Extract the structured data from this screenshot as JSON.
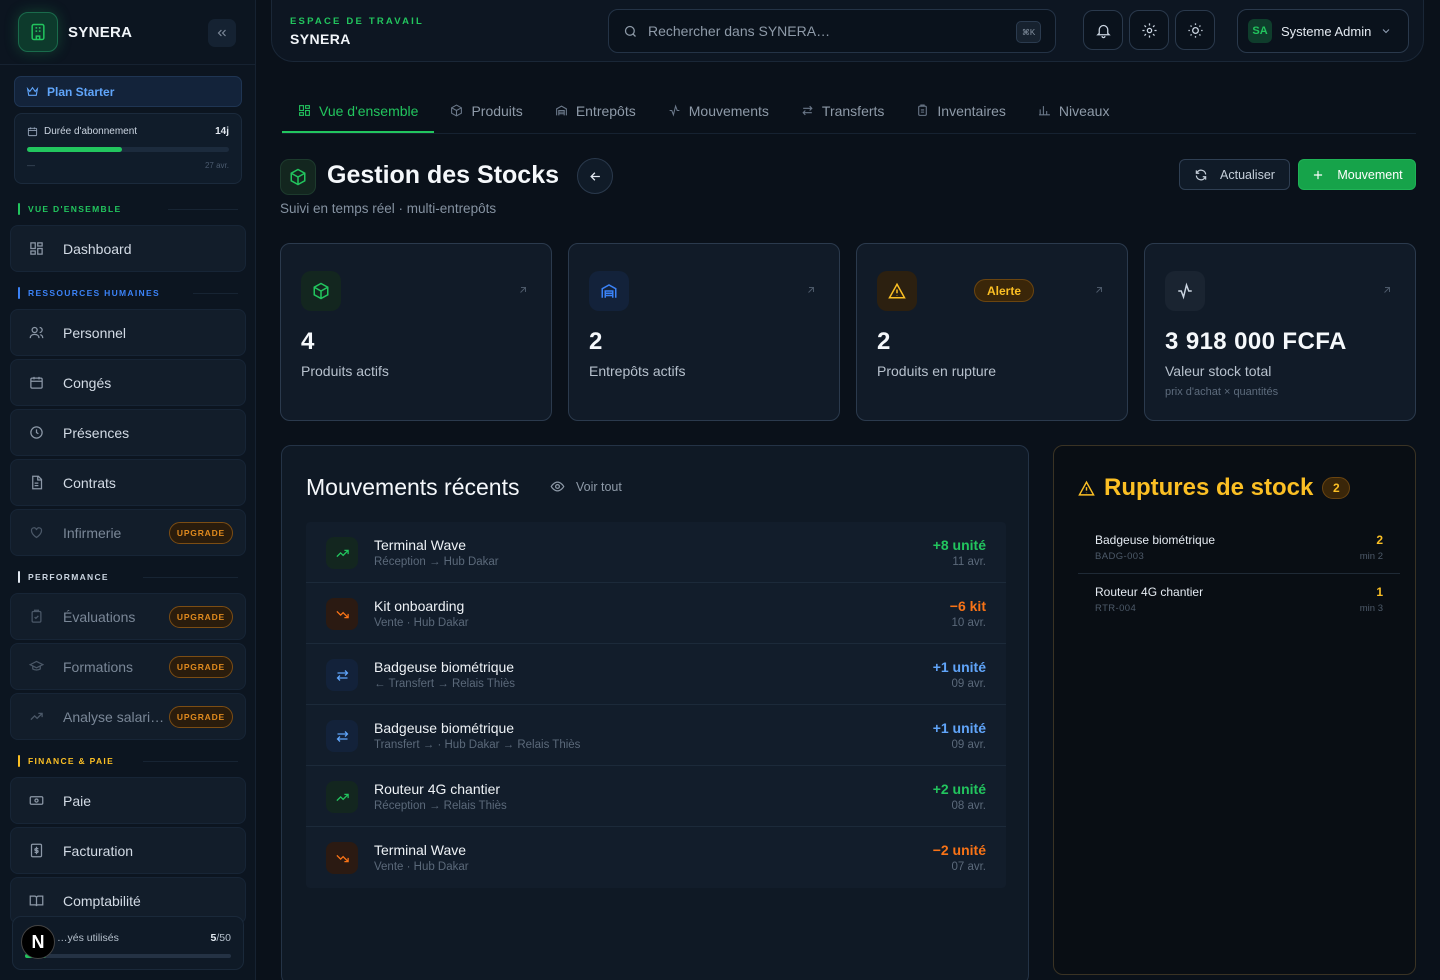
{
  "app": {
    "name": "SYNERA"
  },
  "plan": {
    "label": "Plan Starter"
  },
  "subscription": {
    "label": "Durée d'abonnement",
    "value": "14j",
    "start": "—",
    "end": "27 avr.",
    "progress": 0.47
  },
  "sections": {
    "overview": {
      "label": "VUE D'ENSEMBLE",
      "color": "#22c55e"
    },
    "hr": {
      "label": "RESSOURCES HUMAINES",
      "color": "#3b82f6"
    },
    "performance": {
      "label": "PERFORMANCE",
      "color": "#e2e8f0"
    },
    "finance": {
      "label": "FINANCE & PAIE",
      "color": "#fbbf24"
    }
  },
  "nav": {
    "dashboard": "Dashboard",
    "personnel": "Personnel",
    "conges": "Congés",
    "presences": "Présences",
    "contrats": "Contrats",
    "infirmerie": "Infirmerie",
    "evaluations": "Évaluations",
    "formations": "Formations",
    "analyse": "Analyse salari…",
    "paie": "Paie",
    "facturation": "Facturation",
    "comptabilite": "Comptabilité",
    "upgrade_label": "UPGRADE"
  },
  "usage": {
    "label": "…yés utilisés",
    "used": "5",
    "total": "/50",
    "progress": 0.1,
    "badge": "N"
  },
  "topbar": {
    "workspace_label": "ESPACE DE TRAVAIL",
    "workspace_name": "SYNERA",
    "search_placeholder": "Rechercher dans SYNERA…",
    "shortcut": "⌘K",
    "user_initials": "SA",
    "user_name": "Systeme Admin"
  },
  "tabs": [
    "Vue d'ensemble",
    "Produits",
    "Entrepôts",
    "Mouvements",
    "Transferts",
    "Inventaires",
    "Niveaux"
  ],
  "page": {
    "title": "Gestion des Stocks",
    "subtitle": "Suivi en temps réel · multi-entrepôts",
    "refresh": "Actualiser",
    "new_movement": "Mouvement"
  },
  "stats": [
    {
      "value": "4",
      "label": "Produits actifs",
      "icon": "package-icon",
      "color": "#22c55e"
    },
    {
      "value": "2",
      "label": "Entrepôts actifs",
      "icon": "warehouse-icon",
      "color": "#3b82f6"
    },
    {
      "value": "2",
      "label": "Produits en rupture",
      "icon": "warning-icon",
      "color": "#fbbf24",
      "badge": "Alerte"
    },
    {
      "value": "3 918 000 FCFA",
      "label": "Valeur stock total",
      "note": "prix d'achat × quantités",
      "icon": "activity-icon",
      "color": "#cbd5e1"
    }
  ],
  "movements": {
    "title": "Mouvements récents",
    "link": "Voir tout",
    "items": [
      {
        "name": "Terminal Wave",
        "sub": "Réception → Hub Dakar",
        "qty": "+8 unité",
        "date": "11 avr.",
        "kind": "in"
      },
      {
        "name": "Kit onboarding",
        "sub": "Vente · Hub Dakar",
        "qty": "−6 kit",
        "date": "10 avr.",
        "kind": "out"
      },
      {
        "name": "Badgeuse biométrique",
        "sub": "← Transfert → Relais Thiès",
        "qty": "+1 unité",
        "date": "09 avr.",
        "kind": "transfer"
      },
      {
        "name": "Badgeuse biométrique",
        "sub": "Transfert → · Hub Dakar → Relais Thiès",
        "qty": "+1 unité",
        "date": "09 avr.",
        "kind": "transfer"
      },
      {
        "name": "Routeur 4G chantier",
        "sub": "Réception → Relais Thiès",
        "qty": "+2 unité",
        "date": "08 avr.",
        "kind": "in"
      },
      {
        "name": "Terminal Wave",
        "sub": "Vente · Hub Dakar",
        "qty": "−2 unité",
        "date": "07 avr.",
        "kind": "out"
      }
    ]
  },
  "ruptures": {
    "title": "Ruptures de stock",
    "count": "2",
    "items": [
      {
        "name": "Badgeuse biométrique",
        "sku": "BADG-003",
        "qty": "2",
        "min": "min 2"
      },
      {
        "name": "Routeur 4G chantier",
        "sku": "RTR-004",
        "qty": "1",
        "min": "min 3"
      }
    ]
  },
  "colors": {
    "accent": "#22c55e",
    "blue": "#3b82f6",
    "amber": "#fbbf24",
    "danger": "#f97316"
  }
}
